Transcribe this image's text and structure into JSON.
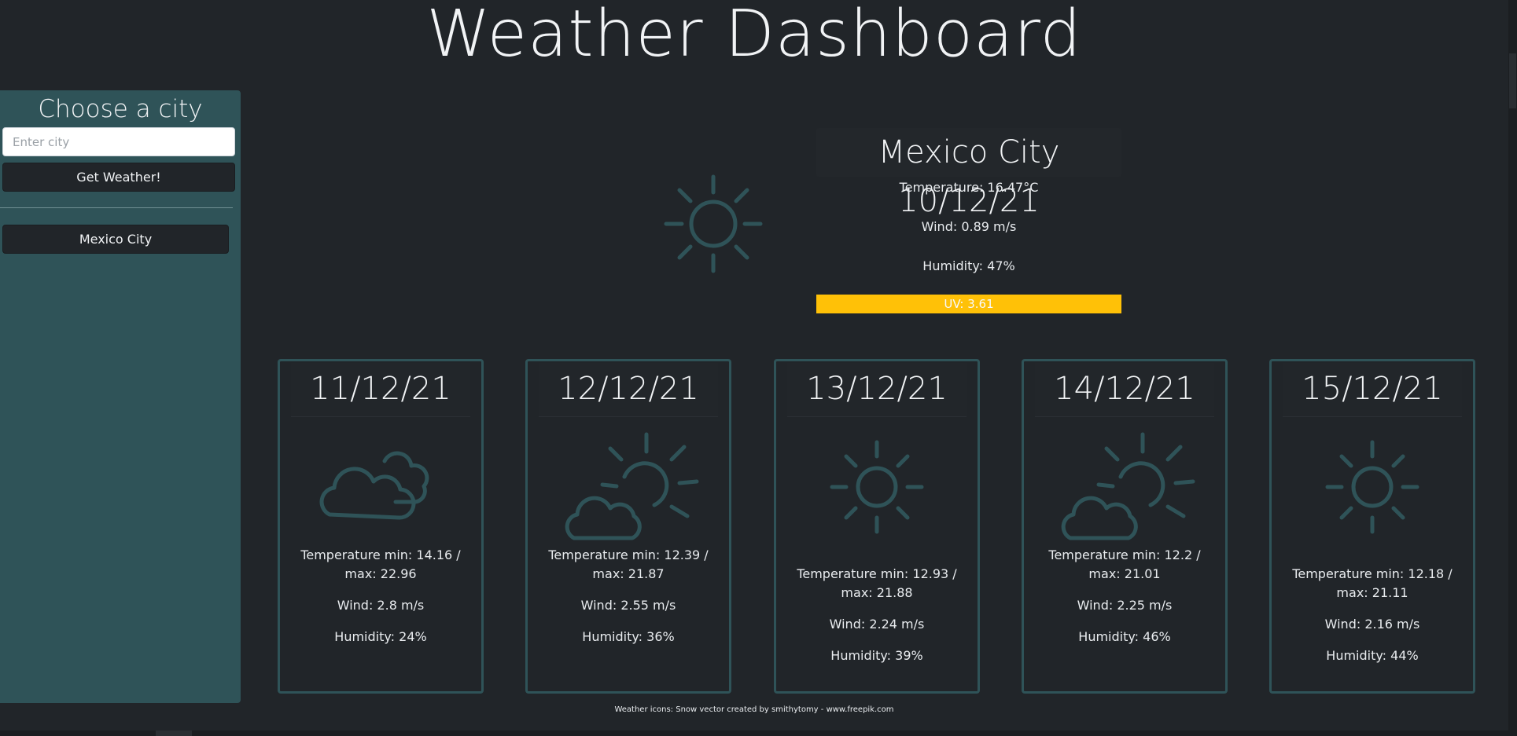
{
  "header": {
    "title": "Weather Dashboard"
  },
  "sidebar": {
    "title": "Choose a city",
    "search_placeholder": "Enter city",
    "search_value": "",
    "get_button_label": "Get Weather!",
    "history": [
      "Mexico City"
    ]
  },
  "current": {
    "title": "Mexico City 10/12/21",
    "icon": "sun-icon",
    "temperature": "Temperature: 16.47°C",
    "wind": "Wind: 0.89 m/s",
    "humidity": "Humidity: 47%",
    "uv": "UV: 3.61",
    "uv_color": "#ffc107"
  },
  "forecast": [
    {
      "date": "11/12/21",
      "icon": "clouds-icon",
      "temp": "Temperature min: 14.16 / max: 22.96",
      "wind": "Wind: 2.8 m/s",
      "humidity": "Humidity: 24%"
    },
    {
      "date": "12/12/21",
      "icon": "sun-behind-cloud-icon",
      "temp": "Temperature min: 12.39 / max: 21.87",
      "wind": "Wind: 2.55 m/s",
      "humidity": "Humidity: 36%"
    },
    {
      "date": "13/12/21",
      "icon": "sun-icon",
      "temp": "Temperature min: 12.93 / max: 21.88",
      "wind": "Wind: 2.24 m/s",
      "humidity": "Humidity: 39%"
    },
    {
      "date": "14/12/21",
      "icon": "sun-behind-cloud-icon",
      "temp": "Temperature min: 12.2 / max: 21.01",
      "wind": "Wind: 2.25 m/s",
      "humidity": "Humidity: 46%"
    },
    {
      "date": "15/12/21",
      "icon": "sun-icon",
      "temp": "Temperature min: 12.18 / max: 21.11",
      "wind": "Wind: 2.16 m/s",
      "humidity": "Humidity: 44%"
    }
  ],
  "footer": {
    "text": "Weather icons: Snow vector created by smithytomy - www.freepik.com"
  },
  "theme": {
    "background": "#212529",
    "accent": "#2f5358",
    "uv_moderate": "#ffc107"
  }
}
